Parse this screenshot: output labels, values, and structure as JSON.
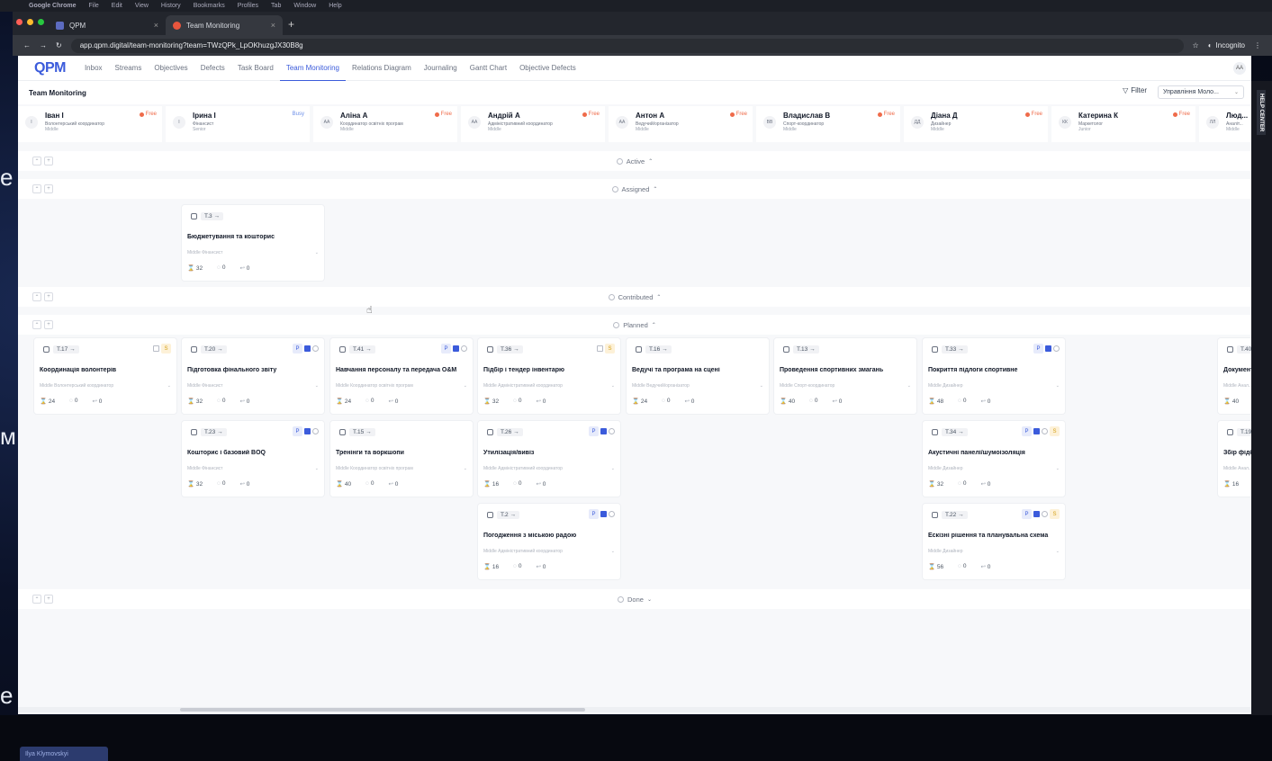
{
  "os_menu": [
    "Google Chrome",
    "File",
    "Edit",
    "View",
    "History",
    "Bookmarks",
    "Profiles",
    "Tab",
    "Window",
    "Help"
  ],
  "browser": {
    "tabs": [
      {
        "label": "QPM",
        "active": false
      },
      {
        "label": "Team Monitoring",
        "active": true
      }
    ],
    "url": "app.qpm.digital/team-monitoring?team=TWzQPk_LpOKhuzgJX30B8g",
    "incognito": "Incognito"
  },
  "app": {
    "logo": "QPM",
    "nav": [
      "Inbox",
      "Streams",
      "Objectives",
      "Defects",
      "Task Board",
      "Team Monitoring",
      "Relations Diagram",
      "Journaling",
      "Gantt Chart",
      "Objective Defects"
    ],
    "active_nav": "Team Monitoring",
    "user_initials": "AA",
    "page_title": "Team Monitoring",
    "filter_label": "Filter",
    "team_select": "Управління Моло...",
    "help_center": "HELP CENTER"
  },
  "members": [
    {
      "ini": "I",
      "name": "Іван І",
      "role": "Волонтерський координатор",
      "level": "Middle",
      "status": "Free"
    },
    {
      "ini": "I",
      "name": "Ірина І",
      "role": "Фінансист",
      "level": "Senior",
      "status": "Busy"
    },
    {
      "ini": "АА",
      "name": "Аліна А",
      "role": "Координатор освітніх програм",
      "level": "Middle",
      "status": "Free"
    },
    {
      "ini": "АА",
      "name": "Андрій А",
      "role": "Адміністративний координатор",
      "level": "Middle",
      "status": "Free"
    },
    {
      "ini": "АА",
      "name": "Антон А",
      "role": "Ведучий/організатор",
      "level": "Middle",
      "status": "Free"
    },
    {
      "ini": "ВВ",
      "name": "Владислав В",
      "role": "Спорт-координатор",
      "level": "Middle",
      "status": "Free"
    },
    {
      "ini": "ДД",
      "name": "Діана Д",
      "role": "Дизайнер",
      "level": "Middle",
      "status": "Free"
    },
    {
      "ini": "КК",
      "name": "Катерина К",
      "role": "Маркетолог",
      "level": "Junior",
      "status": "Free"
    },
    {
      "ini": "ЛЛ",
      "name": "Люд...",
      "role": "Аналіт...",
      "level": "Middle",
      "status": ""
    }
  ],
  "sections": {
    "active": "Active",
    "assigned": "Assigned",
    "contributed": "Contributed",
    "planned": "Planned",
    "done": "Done"
  },
  "cards": [
    {
      "id": "T.3",
      "title": "Бюджетування та кошторис",
      "sub": "Middle Фінансист",
      "n": "32",
      "a": "0",
      "b": "0",
      "col": 1,
      "row": "assigned",
      "tags": ""
    },
    {
      "id": "T.17",
      "title": "Координація волонтерів",
      "sub": "Middle Волонтерський координатор",
      "n": "24",
      "a": "0",
      "b": "0",
      "col": 0,
      "row": 0,
      "tags": "gS"
    },
    {
      "id": "T.20",
      "title": "Підготовка фінального звіту",
      "sub": "Middle Фінансист",
      "n": "32",
      "a": "0",
      "b": "0",
      "col": 1,
      "row": 0,
      "tags": "PLd"
    },
    {
      "id": "T.41",
      "title": "Навчання персоналу та передача O&M",
      "sub": "Middle Координатор освітніх програм",
      "n": "24",
      "a": "0",
      "b": "0",
      "col": 2,
      "row": 0,
      "tags": "PLd"
    },
    {
      "id": "T.36",
      "title": "Підбір і тендер інвентарю",
      "sub": "Middle Адміністративний координатор",
      "n": "32",
      "a": "0",
      "b": "0",
      "col": 3,
      "row": 0,
      "tags": "gS"
    },
    {
      "id": "T.16",
      "title": "Ведучі та програма на сцені",
      "sub": "Middle Ведучий/організатор",
      "n": "24",
      "a": "0",
      "b": "0",
      "col": 4,
      "row": 0,
      "tags": ""
    },
    {
      "id": "T.13",
      "title": "Проведення спортивних змагань",
      "sub": "Middle Спорт-координатор",
      "n": "40",
      "a": "0",
      "b": "0",
      "col": 5,
      "row": 0,
      "tags": ""
    },
    {
      "id": "T.33",
      "title": "Покриття підлоги спортивне",
      "sub": "Middle Дизайнер",
      "n": "48",
      "a": "0",
      "b": "0",
      "col": 6,
      "row": 0,
      "tags": "PLd"
    },
    {
      "id": "T.40",
      "title": "Документ...",
      "sub": "Middle Анал...",
      "n": "40",
      "a": "",
      "b": "",
      "col": 8,
      "row": 0,
      "tags": ""
    },
    {
      "id": "T.23",
      "title": "Кошторис і базовий BOQ",
      "sub": "Middle Фінансист",
      "n": "32",
      "a": "0",
      "b": "0",
      "col": 1,
      "row": 1,
      "tags": "PLd"
    },
    {
      "id": "T.15",
      "title": "Тренінги та воркшопи",
      "sub": "Middle Координатор освітніх програм",
      "n": "40",
      "a": "0",
      "b": "0",
      "col": 2,
      "row": 1,
      "tags": ""
    },
    {
      "id": "T.26",
      "title": "Утилізація/вивіз",
      "sub": "Middle Адміністративний координатор",
      "n": "16",
      "a": "0",
      "b": "0",
      "col": 3,
      "row": 1,
      "tags": "PLd"
    },
    {
      "id": "T.34",
      "title": "Акустичні панелі/шумоізоляція",
      "sub": "Middle Дизайнер",
      "n": "32",
      "a": "0",
      "b": "0",
      "col": 6,
      "row": 1,
      "tags": "PLdS"
    },
    {
      "id": "T.19",
      "title": "Збір фідбе...",
      "sub": "Middle Анал...",
      "n": "16",
      "a": "",
      "b": "",
      "col": 8,
      "row": 1,
      "tags": ""
    },
    {
      "id": "T.2",
      "title": "Погодження з міською радою",
      "sub": "Middle Адміністративний координатор",
      "n": "16",
      "a": "0",
      "b": "0",
      "col": 3,
      "row": 2,
      "tags": "PLd"
    },
    {
      "id": "T.22",
      "title": "Ескізні рішення та планувальна схема",
      "sub": "Middle Дизайнер",
      "n": "56",
      "a": "0",
      "b": "0",
      "col": 6,
      "row": 2,
      "tags": "PLdS"
    }
  ],
  "presenter_label": "Ilya Klymovskyi",
  "slide_edge_chars": [
    "e",
    "м",
    "е"
  ]
}
